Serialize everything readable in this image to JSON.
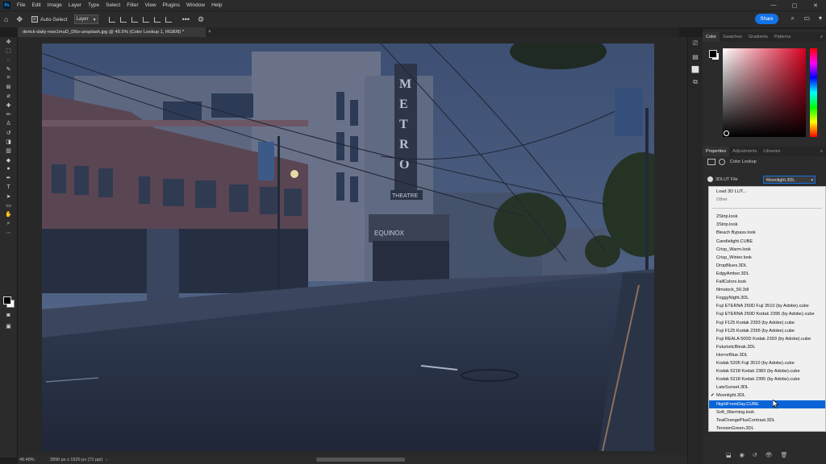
{
  "app": {
    "logo_text": "Ps",
    "menu": [
      "File",
      "Edit",
      "Image",
      "Layer",
      "Type",
      "Select",
      "Filter",
      "View",
      "Plugins",
      "Window",
      "Help"
    ],
    "window_controls": [
      "—",
      "▢",
      "✕"
    ]
  },
  "options_bar": {
    "auto_select_label": "Auto-Select",
    "layer_select_value": "Layer",
    "more_label": "•••",
    "share_label": "Share"
  },
  "document": {
    "tab_title": "derick-daily-nws1muD_D6o-unsplash.jpg @ 49.5% (Color Lookup 1, RGB/8) *",
    "tab_close": "×",
    "zoom": "49.48%",
    "size": "2890 px x 1920 px (72 ppi)"
  },
  "photo_text": {
    "metro_sign": "METRO",
    "theatre_sign": "THEATRE",
    "equinox_sign": "EQUINOX"
  },
  "color_panel": {
    "tabs": [
      "Color",
      "Swatches",
      "Gradients",
      "Patterns"
    ],
    "active_tab": "Color"
  },
  "properties_panel": {
    "tabs": [
      "Properties",
      "Adjustments",
      "Libraries"
    ],
    "header": "Color Lookup",
    "lut_label": "3DLUT File",
    "lut_value": "Moonlight.3DL"
  },
  "lut_dropdown": {
    "top_items": [
      "Load 3D LUT...",
      "Other"
    ],
    "items": [
      "2Strip.look",
      "3Strip.look",
      "Bleach Bypass.look",
      "Candlelight.CUBE",
      "Crisp_Warm.look",
      "Crisp_Winter.look",
      "DropBlues.3DL",
      "EdgyAmber.3DL",
      "FallColors.look",
      "filmstock_50.3dl",
      "FoggyNight.3DL",
      "Fuji ETERNA 250D Fuji 3510 (by Adobe).cube",
      "Fuji ETERNA 250D Kodak 2395 (by Adobe).cube",
      "Fuji F125 Kodak 2393 (by Adobe).cube",
      "Fuji F125 Kodak 2395 (by Adobe).cube",
      "Fuji REALA 500D Kodak 2393 (by Adobe).cube",
      "FuturisticBleak.3DL",
      "HorrorBlue.3DL",
      "Kodak 5205 Fuji 3510 (by Adobe).cube",
      "Kodak 5218 Kodak 2383 (by Adobe).cube",
      "Kodak 5218 Kodak 2395 (by Adobe).cube",
      "LateSunset.3DL",
      "Moonlight.3DL",
      "NightFromDay.CUBE",
      "Soft_Warming.look",
      "TealOrangePlusContrast.3DL",
      "TensionGreen.3DL"
    ],
    "checked_item": "Moonlight.3DL",
    "highlighted_item": "NightFromDay.CUBE",
    "check_mark": "✔"
  },
  "colors": {
    "accent": "#1473e6",
    "highlight": "#0a64d8"
  }
}
